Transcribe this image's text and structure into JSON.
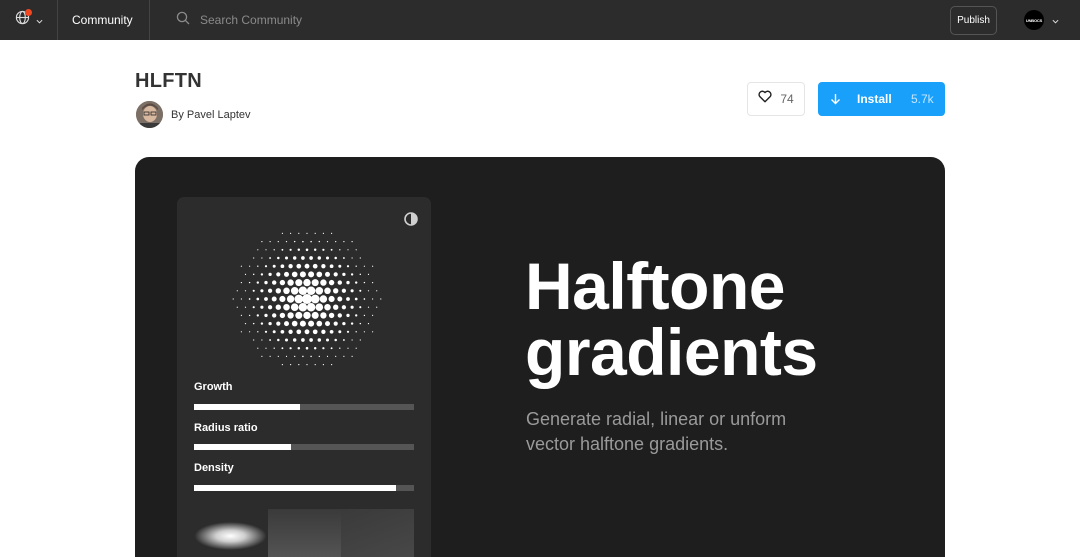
{
  "topbar": {
    "nav_label": "Community",
    "search_placeholder": "Search Community",
    "publish_label": "Publish",
    "profile_badge": "UNBOCS"
  },
  "plugin": {
    "title": "HLFTN",
    "author": "By Pavel Laptev",
    "likes": "74",
    "install_label": "Install",
    "install_count": "5.7k"
  },
  "hero": {
    "headline_line1": "Halftone",
    "headline_line2": "gradients",
    "subtitle": "Generate radial, linear or unform vector halftone gradients.",
    "sliders": [
      {
        "label": "Growth",
        "value": 0.48
      },
      {
        "label": "Radius ratio",
        "value": 0.44
      },
      {
        "label": "Density",
        "value": 0.92
      }
    ]
  },
  "colors": {
    "topbar": "#2c2c2c",
    "accent": "#18a0fb",
    "notification": "#f24822",
    "hero_bg": "#1e1e1e",
    "panel_bg": "#2c2c2c"
  }
}
